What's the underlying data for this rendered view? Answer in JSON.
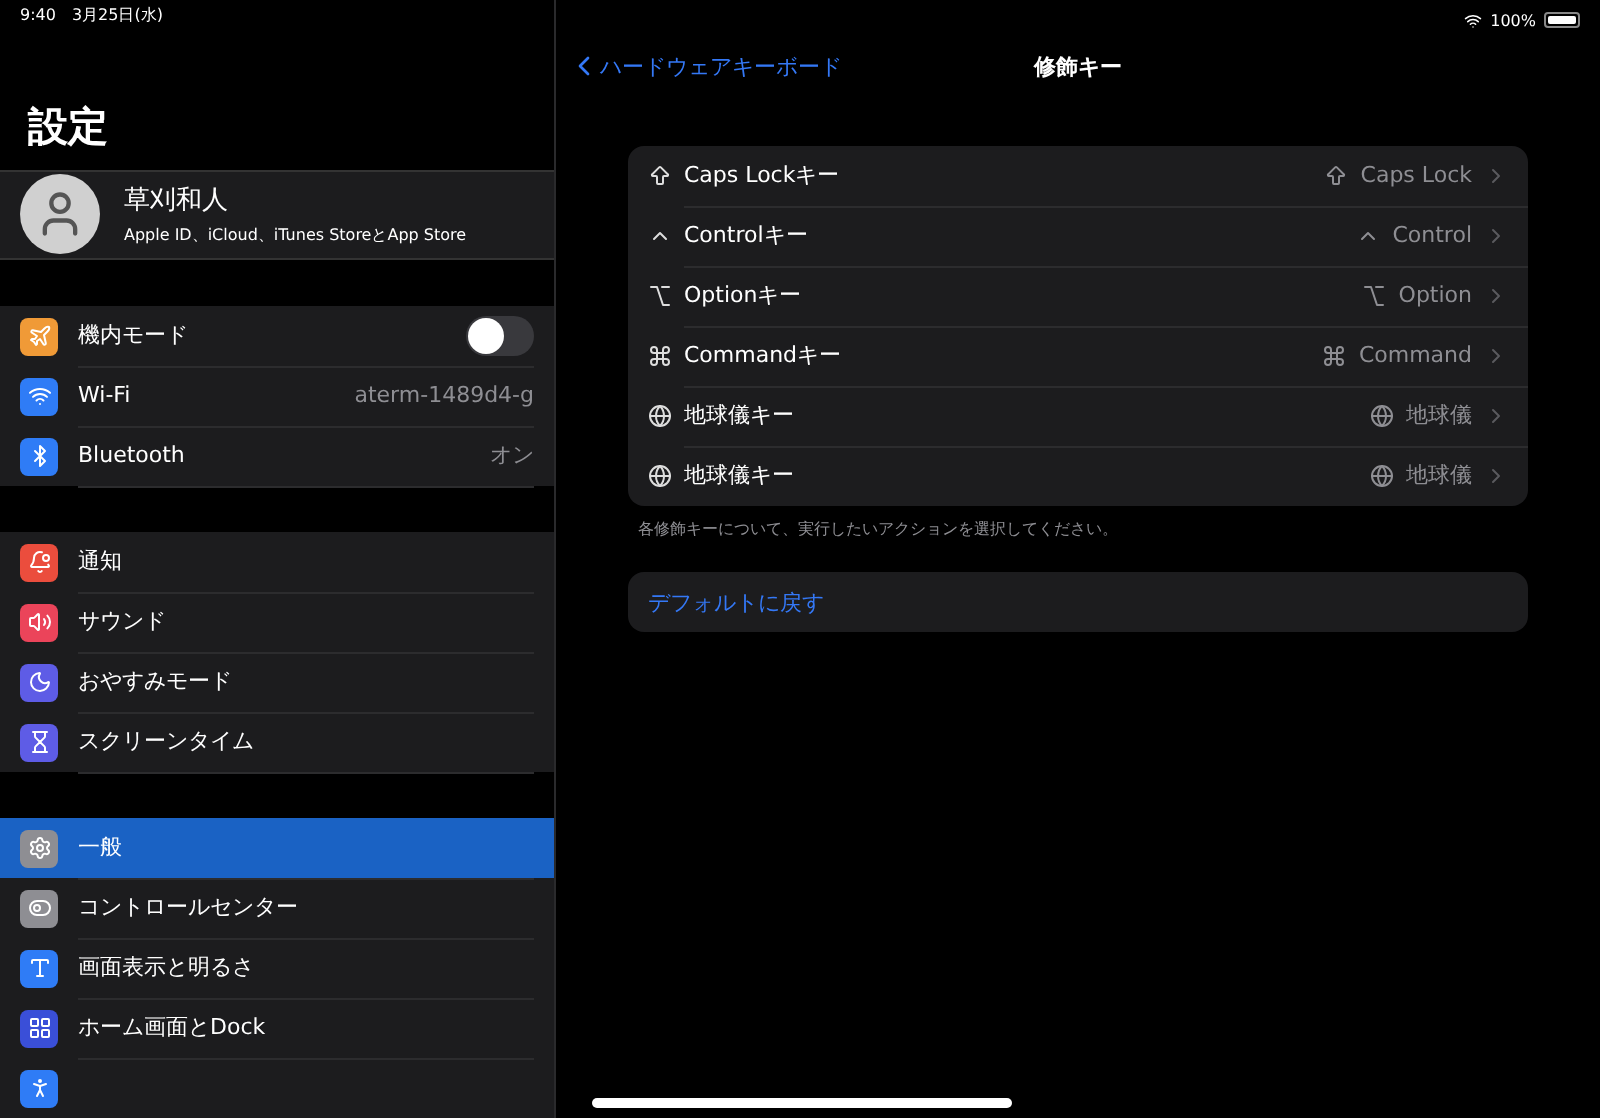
{
  "status_bar": {
    "time": "9:40",
    "date": "3月25日(水)",
    "battery_text": "100%"
  },
  "sidebar": {
    "title": "設定",
    "profile": {
      "name": "草刈和人",
      "subtitle": "Apple ID、iCloud、iTunes StoreとApp Store"
    },
    "groups": [
      [
        {
          "kind": "airplane",
          "label": "機内モード",
          "color": "#f09a37",
          "selected": false,
          "toggle": {
            "on": false
          }
        },
        {
          "kind": "wifi",
          "label": "Wi-Fi",
          "color": "#2f7cf6",
          "selected": false,
          "value": "aterm-1489d4-g"
        },
        {
          "kind": "bluetooth",
          "label": "Bluetooth",
          "color": "#2f7cf6",
          "selected": false,
          "value": "オン"
        }
      ],
      [
        {
          "kind": "notifications",
          "label": "通知",
          "color": "#eb4d3d",
          "selected": false
        },
        {
          "kind": "sound",
          "label": "サウンド",
          "color": "#eb445a",
          "selected": false
        },
        {
          "kind": "moon",
          "label": "おやすみモード",
          "color": "#5e5ce6",
          "selected": false
        },
        {
          "kind": "hourglass",
          "label": "スクリーンタイム",
          "color": "#5e5ce6",
          "selected": false
        }
      ],
      [
        {
          "kind": "gear",
          "label": "一般",
          "color": "#8e8e93",
          "selected": true
        },
        {
          "kind": "switches",
          "label": "コントロールセンター",
          "color": "#8e8e93",
          "selected": false
        },
        {
          "kind": "text",
          "label": "画面表示と明るさ",
          "color": "#2f7cf6",
          "selected": false
        },
        {
          "kind": "grid",
          "label": "ホーム画面とDock",
          "color": "#3a4fd8",
          "selected": false
        },
        {
          "kind": "accessibility",
          "color": "#2f7cf6",
          "selected": false
        }
      ]
    ]
  },
  "detail": {
    "back": "ハードウェアキーボード",
    "title": "修飾キー",
    "keys": [
      {
        "kind": "caps",
        "label": "Caps Lockキー",
        "value": "Caps Lock"
      },
      {
        "kind": "control",
        "label": "Controlキー",
        "value": "Control"
      },
      {
        "kind": "option",
        "label": "Optionキー",
        "value": "Option"
      },
      {
        "kind": "command",
        "label": "Commandキー",
        "value": "Command"
      },
      {
        "kind": "globe",
        "label": "地球儀キー",
        "value": "地球儀"
      },
      {
        "kind": "globe",
        "label": "地球儀キー",
        "value": "地球儀"
      }
    ],
    "note": "各修飾キーについて、実行したいアクションを選択してください。",
    "reset": "デフォルトに戻す"
  }
}
